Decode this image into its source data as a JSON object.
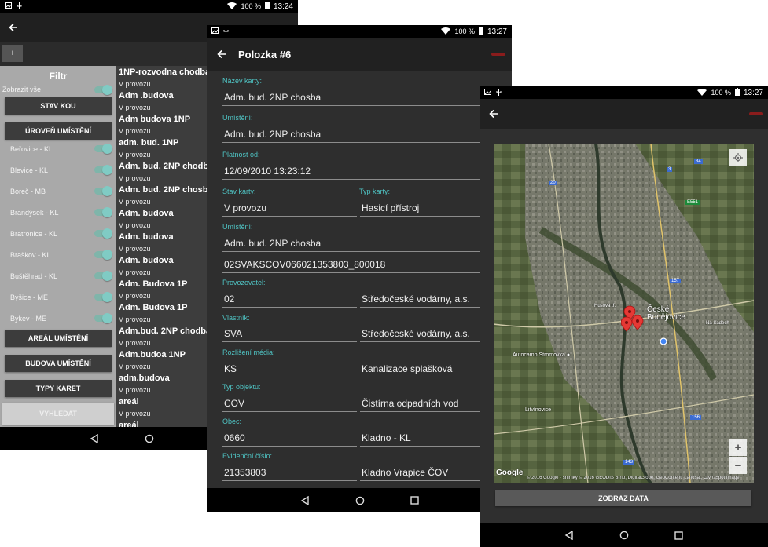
{
  "screen1": {
    "status": {
      "battery": "100 %",
      "time": "13:24"
    },
    "add_label": "+",
    "filter": {
      "title": "Filtr",
      "show_all": "Zobrazit vše",
      "btn_stav": "STAV KOU",
      "btn_uroven": "ÚROVEŇ UMÍSTĚNÍ",
      "locations": [
        "Beřovice - KL",
        "Blevice - KL",
        "Boreč - MB",
        "Brandýsek - KL",
        "Bratronice - KL",
        "Braškov - KL",
        "Buštěhrad - KL",
        "Byšice - ME",
        "Bykev - ME"
      ],
      "btn_areal": "AREÁL UMÍSTĚNÍ",
      "btn_budova": "BUDOVA UMÍSTĚNÍ",
      "btn_typy": "TYPY KARET",
      "btn_vyhledat": "VYHLEDAT"
    },
    "list": [
      {
        "title": "1NP-rozvodna  chodba",
        "sub": "V provozu"
      },
      {
        "title": "Adm .budova",
        "sub": "V provozu"
      },
      {
        "title": "Adm budova 1NP",
        "sub": "V provozu"
      },
      {
        "title": "adm. bud. 1NP",
        "sub": "V provozu"
      },
      {
        "title": "Adm. bud. 2NP chodba",
        "sub": "V provozu"
      },
      {
        "title": "Adm. bud. 2NP chosba",
        "sub": "V provozu"
      },
      {
        "title": "Adm. budova",
        "sub": "V provozu"
      },
      {
        "title": "Adm. budova",
        "sub": "V provozu"
      },
      {
        "title": "Adm. budova",
        "sub": "V provozu"
      },
      {
        "title": "Adm. Budova 1P",
        "sub": "V provozu"
      },
      {
        "title": "Adm. Budova 1P",
        "sub": "V provozu"
      },
      {
        "title": "Adm.bud. 2NP chodba",
        "sub": "V provozu"
      },
      {
        "title": "Adm.budoa 1NP",
        "sub": "V provozu"
      },
      {
        "title": "adm.budova",
        "sub": "V provozu"
      },
      {
        "title": "areál",
        "sub": "V provozu"
      },
      {
        "title": "areál",
        "sub": ""
      }
    ]
  },
  "screen2": {
    "status": {
      "battery": "100 %",
      "time": "13:27"
    },
    "title": "Polozka #6",
    "fields": {
      "nazev_label": "Název karty:",
      "nazev": "Adm. bud. 2NP chosba",
      "umisteni_label": "Umístění:",
      "umisteni": "Adm. bud. 2NP chosba",
      "platnost_label": "Platnost od:",
      "platnost": "12/09/2010 13:23:12",
      "stav_label": "Stav karty:",
      "stav": "V provozu",
      "typ_label": "Typ karty:",
      "typ": "Hasicí přístroj",
      "umisteni2_label": "Umístění:",
      "umisteni2": "Adm. bud. 2NP chosba",
      "kod": "02SVAKSCOV066021353803_800018",
      "provozovatel_label": "Provozovatel:",
      "provozovatel_code": "02",
      "provozovatel_name": "Středočeské vodárny, a.s.",
      "vlastnik_label": "Vlastník:",
      "vlastnik_code": "SVA",
      "vlastnik_name": "Středočeské vodárny, a.s.",
      "rozliseni_label": "Rozlišení média:",
      "rozliseni_code": "KS",
      "rozliseni_name": "Kanalizace splašková",
      "typobj_label": "Typ objektu:",
      "typobj_code": "COV",
      "typobj_name": "Čistírna odpadních vod",
      "obec_label": "Obec:",
      "obec_code": "0660",
      "obec_name": "Kladno - KL",
      "evid_label": "Evidenční číslo:",
      "evid_code": "21353803",
      "evid_name": "Kladno Vrapice ČOV"
    }
  },
  "screen3": {
    "status": {
      "battery": "100 %",
      "time": "13:27"
    },
    "map": {
      "city_line1": "České",
      "city_line2": "Budějovice",
      "place_autocamp": "Autocamp Stromovka",
      "place_litvinovice": "Litvínovice",
      "place_husova": "Husova tř.",
      "place_na_sadech": "Na Sadech",
      "road_e551": "E551",
      "road_20": "20",
      "road_34": "34",
      "road_3": "3",
      "road_157": "157",
      "road_156": "156",
      "road_143": "143",
      "google": "Google",
      "attribution": "© 2016 Google · snímky © 2016 GEODIS Brno, DigitalGlobe, GeoContent, Landsat, Čtvrť/Spot Image,",
      "zoom_in": "+",
      "zoom_out": "−"
    },
    "show_data": "ZOBRAZ DATA"
  }
}
